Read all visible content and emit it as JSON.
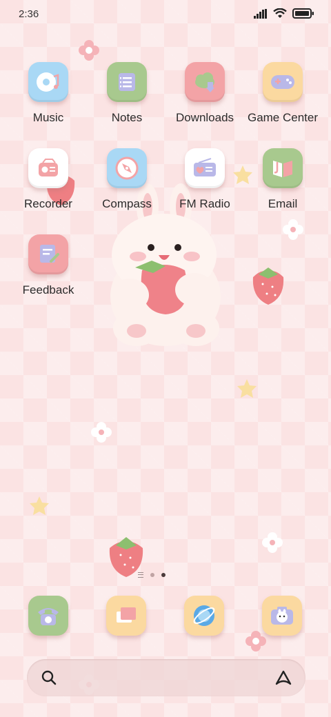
{
  "status_bar": {
    "time": "2:36"
  },
  "apps": [
    {
      "name": "Music",
      "icon": "music-disc-icon"
    },
    {
      "name": "Notes",
      "icon": "notes-icon"
    },
    {
      "name": "Downloads",
      "icon": "cloud-download-icon"
    },
    {
      "name": "Game Center",
      "icon": "gamepad-icon"
    },
    {
      "name": "Recorder",
      "icon": "radio-recorder-icon"
    },
    {
      "name": "Compass",
      "icon": "compass-icon"
    },
    {
      "name": "FM Radio",
      "icon": "fm-radio-icon"
    },
    {
      "name": "Email",
      "icon": "email-book-icon"
    },
    {
      "name": "Feedback",
      "icon": "feedback-icon"
    }
  ],
  "dock": [
    {
      "icon": "telephone-icon"
    },
    {
      "icon": "messages-icon"
    },
    {
      "icon": "browser-icon"
    },
    {
      "icon": "camera-icon"
    }
  ],
  "page_indicator": {
    "pages": 2,
    "active": 2
  },
  "search_bar": {
    "left_icon": "search-icon",
    "right_icon": "assistant-icon"
  },
  "colors": {
    "background": "#fbe3e3",
    "tile_blue": "#a9d8f5",
    "tile_green": "#a8c98e",
    "tile_pink": "#f3a3a6",
    "tile_yellow": "#fbd9a0",
    "tile_white": "#ffffff"
  }
}
